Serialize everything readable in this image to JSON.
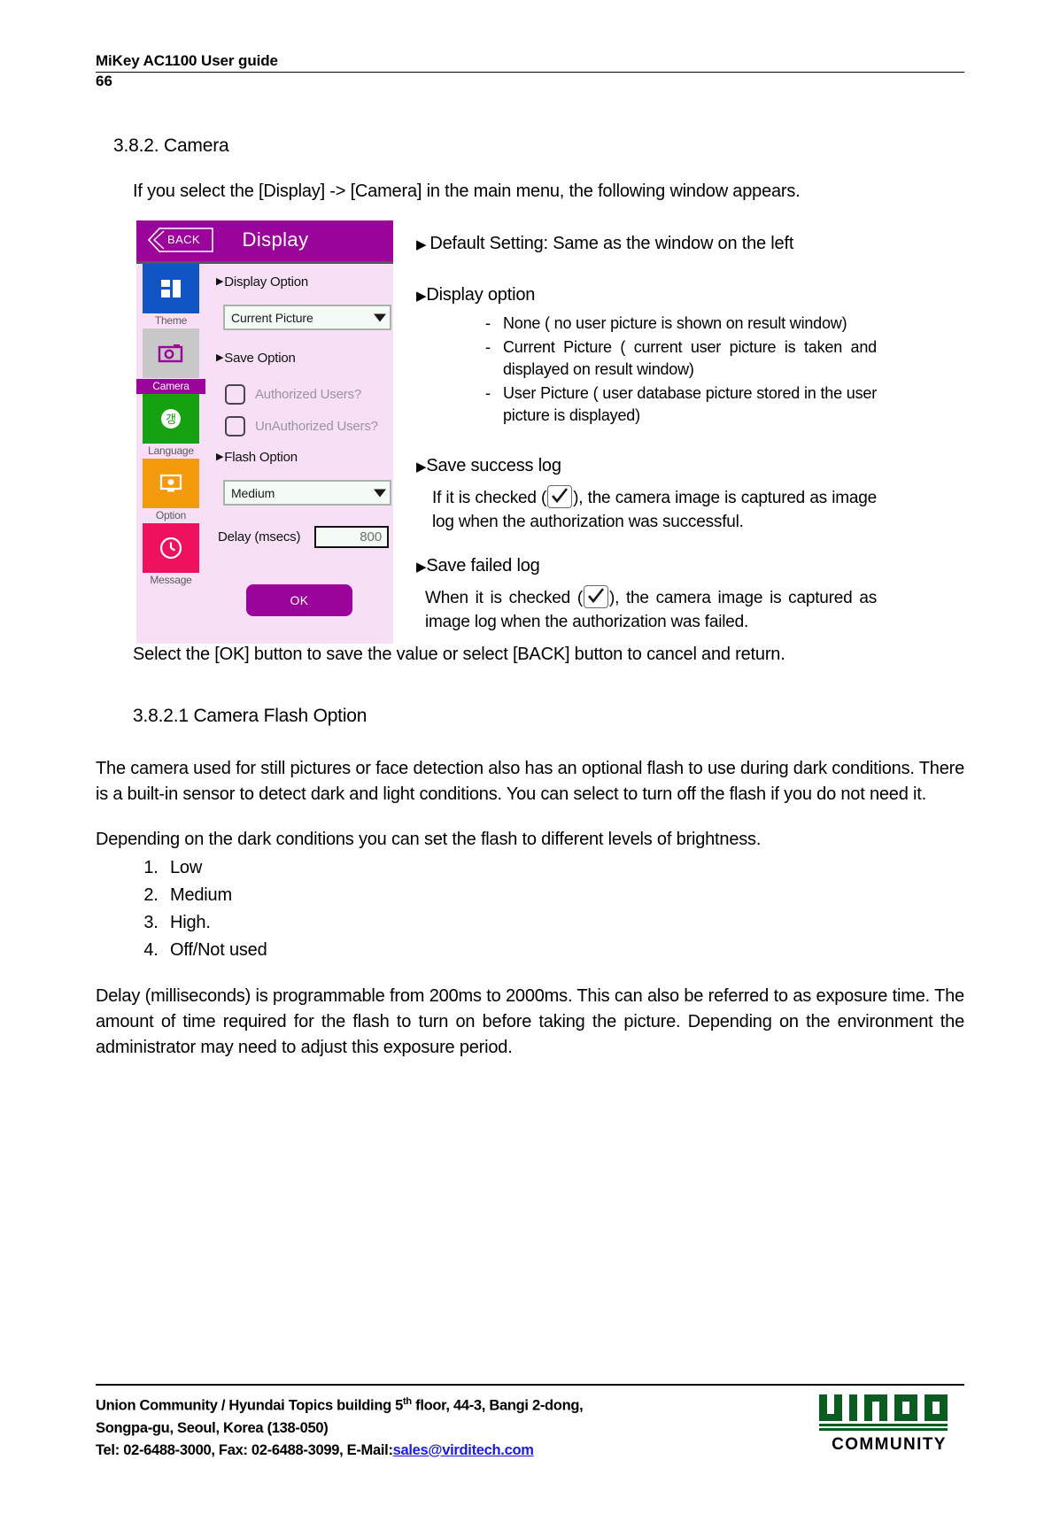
{
  "header": {
    "title": "MiKey AC1100 User guide",
    "page_number": "66"
  },
  "section": {
    "heading": "3.8.2. Camera",
    "intro": "If you select the [Display] -> [Camera] in the main menu, the following window appears.",
    "closing": "Select the [OK] button to save the value or select [BACK] button to cancel and return."
  },
  "device": {
    "back_button": "BACK",
    "title": "Display",
    "sidebar": [
      {
        "label": "Theme",
        "icon": "theme-icon",
        "color": "#1155c4",
        "selected": false
      },
      {
        "label": "Camera",
        "icon": "camera-icon",
        "color": "#c8c8c8",
        "selected": true
      },
      {
        "label": "Language",
        "icon": "language-icon",
        "color": "#16a111",
        "selected": false
      },
      {
        "label": "Option",
        "icon": "monitor-icon",
        "color": "#f59b0b",
        "selected": false
      },
      {
        "label": "Message",
        "icon": "clock-icon",
        "color": "#f0115e",
        "selected": false
      }
    ],
    "display_option_label": "Display Option",
    "display_option_value": "Current Picture",
    "save_option_label": "Save Option",
    "checkboxes": [
      {
        "label": "Authorized Users?",
        "checked": false
      },
      {
        "label": "UnAuthorized Users?",
        "checked": false
      }
    ],
    "flash_option_label": "Flash Option",
    "flash_option_value": "Medium",
    "delay_label": "Delay (msecs)",
    "delay_value": "800",
    "ok_button": "OK",
    "title_bar_color": "#9b049b",
    "panel_color": "#f7e0f5"
  },
  "annotations": {
    "default_setting": "Default Setting: Same as the window on the left",
    "display_option_head": "Display option",
    "display_option_items": [
      "None ( no user picture is shown on result window)",
      "Current Picture ( current user picture is taken and displayed on result window)",
      "User Picture ( user database picture stored in the user picture is displayed)"
    ],
    "save_success_head": "Save success log",
    "save_success_text_before": "If it is checked (",
    "save_success_text_after": "), the camera image is captured as image log when the authorization was successful.",
    "save_failed_head": "Save failed log",
    "save_failed_text_before": "When it is checked (",
    "save_failed_text_after": "), the camera image is captured as image log when the authorization was failed."
  },
  "flash_section": {
    "heading": "3.8.2.1 Camera Flash Option",
    "paragraph1": "The camera used for still pictures or face detection also has an optional flash to use during dark conditions. There is a built-in sensor to detect dark and light conditions. You can select to turn off the flash if you do not need it.",
    "paragraph2": "Depending on the dark conditions you can set the flash to different levels of brightness.",
    "levels": [
      "Low",
      "Medium",
      "High.",
      "Off/Not used"
    ],
    "paragraph3": "Delay (milliseconds) is programmable from 200ms to 2000ms. This can also be referred to as exposure time. The amount of time required for the flash to turn on before taking the picture. Depending on the environment the administrator may need to adjust this exposure period."
  },
  "footer": {
    "line1_a": "Union Community / Hyundai Topics building 5",
    "line1_sup": "th",
    "line1_b": " floor, 44-3, Bangi 2-dong,",
    "line2": "Songpa-gu, Seoul, Korea (138-050)",
    "line3_a": "Tel: 02-6488-3000, Fax: 02-6488-3099, E-Mail:",
    "email": "sales@virditech.com",
    "logo_text": "UNION",
    "logo_word": "COMMUNITY",
    "logo_color": "#0b5c21"
  }
}
